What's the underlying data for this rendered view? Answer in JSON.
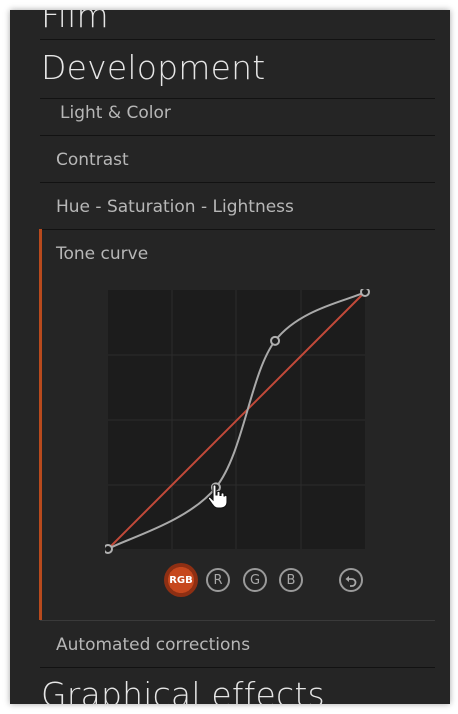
{
  "sections": {
    "film": "Film",
    "development": "Development",
    "graphical_effects": "Graphical effects"
  },
  "development_items": {
    "light_color": "Light & Color",
    "contrast": "Contrast",
    "hsl": "Hue - Saturation - Lightness",
    "tone_curve": "Tone curve",
    "automated_corrections": "Automated corrections"
  },
  "tone_curve": {
    "channels": [
      {
        "label": "RGB",
        "active": true
      },
      {
        "label": "R",
        "active": false
      },
      {
        "label": "G",
        "active": false
      },
      {
        "label": "B",
        "active": false
      }
    ],
    "reset_icon": "undo-icon",
    "control_points": [
      {
        "input": 0,
        "output": 0
      },
      {
        "input": 0.42,
        "output": 0.24
      },
      {
        "input": 0.65,
        "output": 0.81
      },
      {
        "input": 1,
        "output": 1
      }
    ],
    "colors": {
      "accent": "#b84a1d",
      "reference_line": "#c24a3a",
      "curve": "#a9a9a9",
      "active_button": "#c6471d"
    }
  }
}
